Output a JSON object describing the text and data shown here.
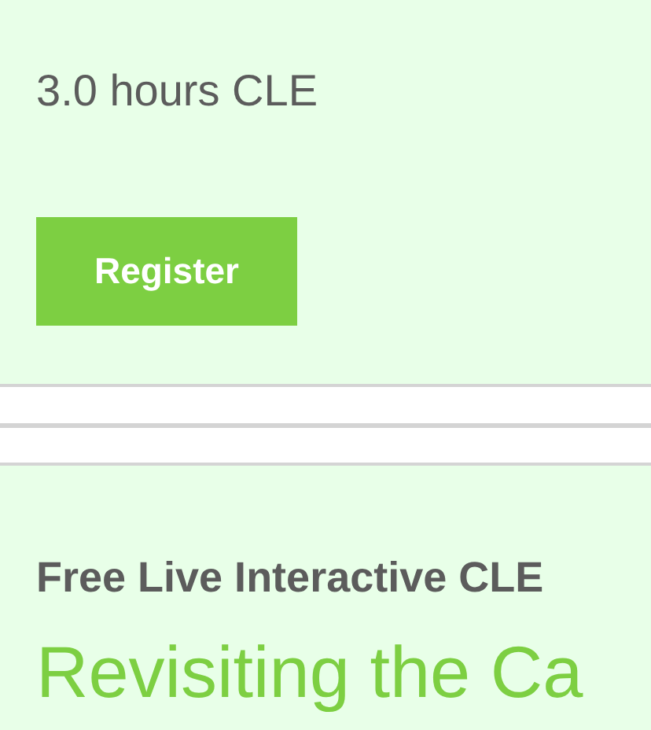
{
  "event_1": {
    "credit": "3.0 hours CLE",
    "button": "Register"
  },
  "event_2": {
    "category": "Free Live Interactive CLE",
    "title": "Revisiting the Ca"
  }
}
